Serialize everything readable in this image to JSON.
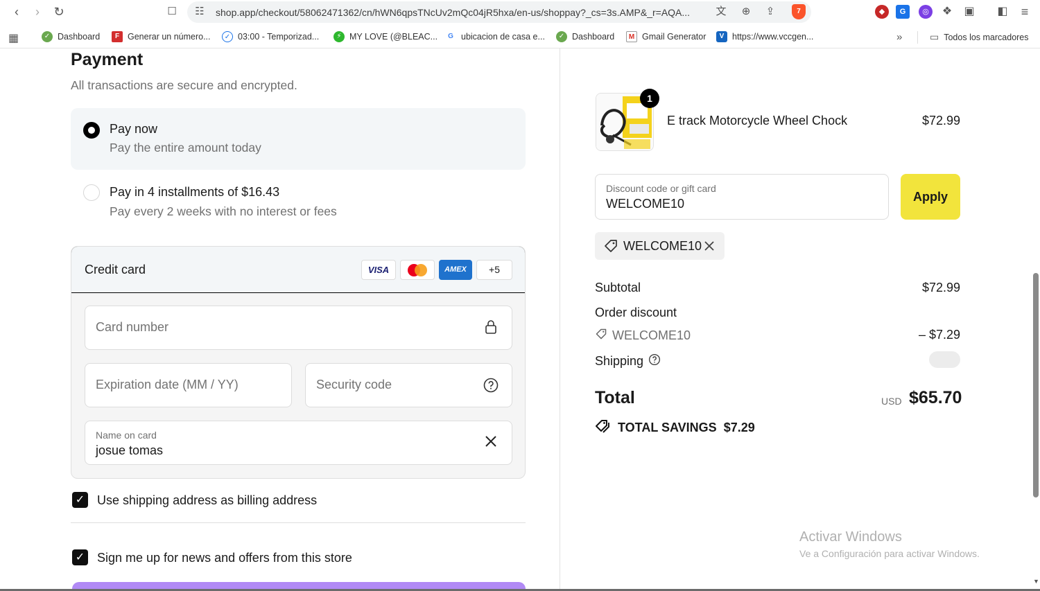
{
  "browser": {
    "url": "shop.app/checkout/58062471362/cn/hWN6qpsTNcUv2mQc04jR5hxa/en-us/shoppay?_cs=3s.AMP&_r=AQA...",
    "icons": [
      "back-arrow-icon",
      "forward-arrow-icon",
      "reload-icon",
      "bookmark-icon",
      "site-info-icon",
      "translate-icon",
      "zoom-icon",
      "share-icon",
      "brave-shield-icon"
    ],
    "brave_count": "7",
    "bookmarks": [
      {
        "label": "Dashboard",
        "icon": "dashboard-icon"
      },
      {
        "label": "Generar un número...",
        "icon": "f-logo-icon"
      },
      {
        "label": "03:00 - Temporizad...",
        "icon": "timer-icon"
      },
      {
        "label": "MY LOVE (@BLEAC...",
        "icon": "bolt-icon"
      },
      {
        "label": "ubicacion de casa e...",
        "icon": "google-icon"
      },
      {
        "label": "Dashboard",
        "icon": "dashboard-icon"
      },
      {
        "label": "Gmail Generator",
        "icon": "gmail-icon"
      },
      {
        "label": "https://www.vccgen...",
        "icon": "v-logo-icon"
      }
    ],
    "all_bookmarks_label": "Todos los marcadores"
  },
  "payment": {
    "title": "Payment",
    "subtitle": "All transactions are secure and encrypted.",
    "options": [
      {
        "title": "Pay now",
        "subtitle": "Pay the entire amount today",
        "selected": true
      },
      {
        "title": "Pay in 4 installments of $16.43",
        "subtitle": "Pay every 2 weeks with no interest or fees",
        "selected": false
      }
    ],
    "credit_card": {
      "title": "Credit card",
      "brands": [
        "VISA",
        "",
        "AMEX",
        "+5"
      ],
      "card_number_placeholder": "Card number",
      "expiration_placeholder": "Expiration date (MM / YY)",
      "security_placeholder": "Security code",
      "name_label": "Name on card",
      "name_value": "josue tomas"
    },
    "billing_checkbox": "Use shipping address as billing address",
    "newsletter_checkbox": "Sign me up for news and offers from this store"
  },
  "summary": {
    "product": {
      "name": "E track Motorcycle Wheel Chock",
      "price": "$72.99",
      "quantity": "1"
    },
    "discount": {
      "label": "Discount code or gift card",
      "value": "WELCOME10",
      "apply_label": "Apply",
      "applied_code": "WELCOME10"
    },
    "subtotal_label": "Subtotal",
    "subtotal_value": "$72.99",
    "order_discount_label": "Order discount",
    "order_discount_code": "WELCOME10",
    "order_discount_value": "– $7.29",
    "shipping_label": "Shipping",
    "total_label": "Total",
    "total_currency": "USD",
    "total_value": "$65.70",
    "savings_label": "TOTAL SAVINGS",
    "savings_value": "$7.29"
  },
  "windows_watermark": {
    "title": "Activar Windows",
    "subtitle": "Ve a Configuración para activar Windows."
  },
  "colors": {
    "apply_button": "#f2e43c",
    "pay_button": "#b18af5",
    "selected_option_bg": "#f3f6f8"
  }
}
